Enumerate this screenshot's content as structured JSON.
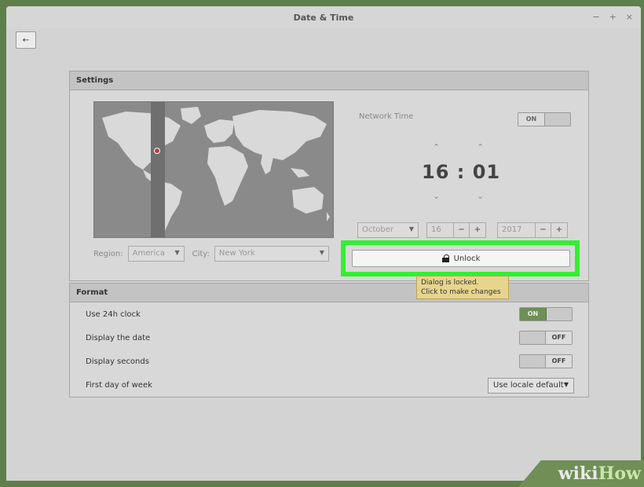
{
  "window": {
    "title": "Date & Time",
    "controls": [
      "−",
      "+",
      "×"
    ],
    "back_icon": "←"
  },
  "settings": {
    "header": "Settings",
    "network_time_label": "Network Time",
    "network_time_switch": "ON",
    "time": "16 : 01",
    "region_label": "Region:",
    "region_value": "America",
    "city_label": "City:",
    "city_value": "New York",
    "month": "October",
    "day": "16",
    "year": "2017",
    "minus": "−",
    "plus": "+",
    "unlock_label": "Unlock",
    "tooltip_line1": "Dialog is locked.",
    "tooltip_line2": "Click to make changes"
  },
  "format": {
    "header": "Format",
    "use24h_label": "Use 24h clock",
    "use24h_value": "ON",
    "display_date_label": "Display the date",
    "display_date_value": "OFF",
    "display_seconds_label": "Display seconds",
    "display_seconds_value": "OFF",
    "first_day_label": "First day of week",
    "first_day_value": "Use locale default"
  },
  "watermark": {
    "part1": "wiki",
    "part2": "How"
  },
  "colors": {
    "highlight": "#33ee33",
    "accent_on": "#6e8f58",
    "tooltip_bg": "#e7d58d"
  }
}
